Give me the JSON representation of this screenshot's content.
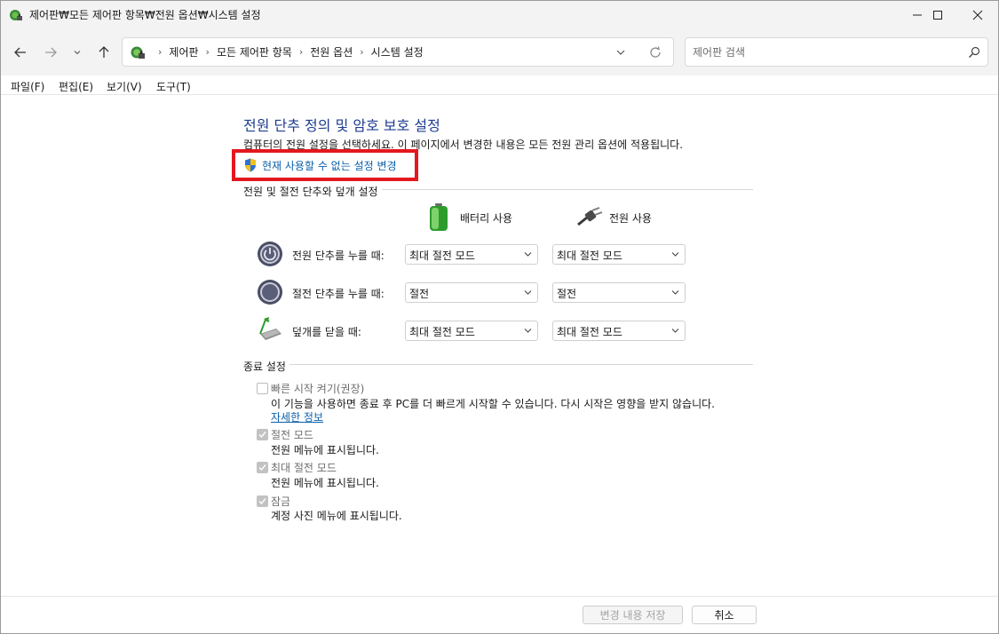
{
  "window": {
    "title": "제어판₩모든 제어판 항목₩전원 옵션₩시스템 설정"
  },
  "address": {
    "crumbs": [
      "제어판",
      "모든 제어판 항목",
      "전원 옵션",
      "시스템 설정"
    ]
  },
  "search": {
    "placeholder": "제어판 검색"
  },
  "menu": {
    "items": [
      "파일(F)",
      "편집(E)",
      "보기(V)",
      "도구(T)"
    ]
  },
  "main": {
    "heading": "전원 단추 정의 및 암호 보호 설정",
    "description": "컴퓨터의 전원 설정을 선택하세요. 이 페이지에서 변경한 내용은 모든 전원 관리 옵션에 적용됩니다.",
    "change_link": "현재 사용할 수 없는 설정 변경",
    "power_group_title": "전원 및 절전 단추와 덮개 설정",
    "columns": {
      "battery": "배터리 사용",
      "plugged": "전원 사용"
    },
    "rows": [
      {
        "label": "전원 단추를 누를 때:",
        "battery": "최대 절전 모드",
        "plugged": "최대 절전 모드"
      },
      {
        "label": "절전 단추를 누를 때:",
        "battery": "절전",
        "plugged": "절전"
      },
      {
        "label": "덮개를 닫을 때:",
        "battery": "최대 절전 모드",
        "plugged": "최대 절전 모드"
      }
    ],
    "shutdown_group_title": "종료 설정",
    "shutdown": {
      "fast_startup": {
        "label": "빠른 시작 켜기(권장)",
        "desc": "이 기능을 사용하면 종료 후 PC를 더 빠르게 시작할 수 있습니다. 다시 시작은 영향을 받지 않습니다.",
        "link": "자세한 정보",
        "checked": false
      },
      "sleep": {
        "label": "절전 모드",
        "desc": "전원 메뉴에 표시됩니다.",
        "checked": true
      },
      "hibernate": {
        "label": "최대 절전 모드",
        "desc": "전원 메뉴에 표시됩니다.",
        "checked": true
      },
      "lock": {
        "label": "잠금",
        "desc": "계정 사진 메뉴에 표시됩니다.",
        "checked": true
      }
    }
  },
  "footer": {
    "save_label": "변경 내용 저장",
    "cancel_label": "취소"
  },
  "colors": {
    "heading": "#1e3d8f",
    "link": "#0b5fa9",
    "highlight": "#e3181e"
  }
}
